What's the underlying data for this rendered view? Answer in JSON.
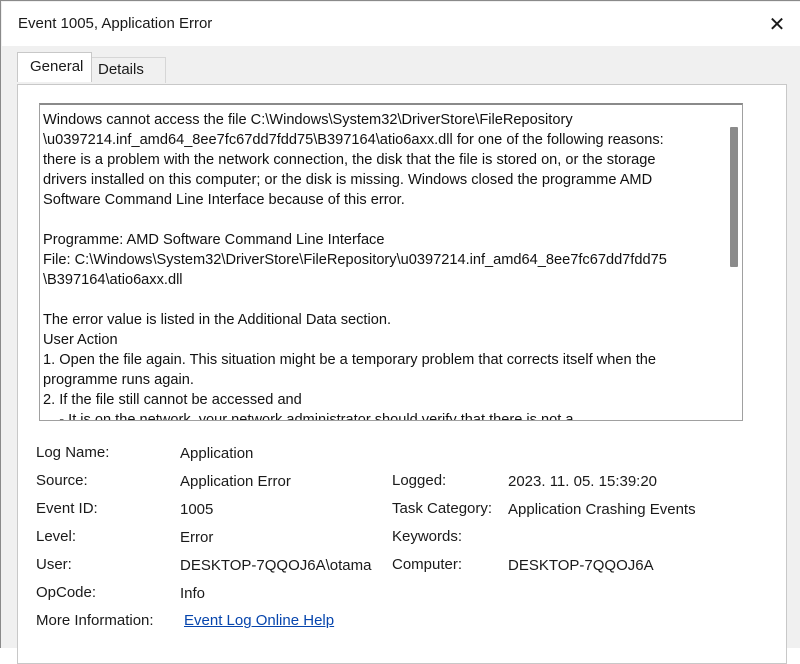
{
  "window": {
    "title": "Event 1005, Application Error",
    "close_glyph": "✕"
  },
  "tabs": [
    {
      "label": "General",
      "active": true
    },
    {
      "label": "Details",
      "active": false
    }
  ],
  "description": "Windows cannot access the file C:\\Windows\\System32\\DriverStore\\FileRepository\n\\u0397214.inf_amd64_8ee7fc67dd7fdd75\\B397164\\atio6axx.dll for one of the following reasons:\nthere is a problem with the network connection, the disk that the file is stored on, or the storage\ndrivers installed on this computer; or the disk is missing. Windows closed the programme AMD\nSoftware Command Line Interface because of this error.\n\nProgramme: AMD Software Command Line Interface\nFile: C:\\Windows\\System32\\DriverStore\\FileRepository\\u0397214.inf_amd64_8ee7fc67dd7fdd75\n\\B397164\\atio6axx.dll\n\nThe error value is listed in the Additional Data section.\nUser Action\n1. Open the file again. This situation might be a temporary problem that corrects itself when the\nprogramme runs again.\n2. If the file still cannot be accessed and\n    - It is on the network, your network administrator should verify that there is not a",
  "fields": {
    "log_name": {
      "label": "Log Name:",
      "value": "Application"
    },
    "source": {
      "label": "Source:",
      "value": "Application Error"
    },
    "logged": {
      "label": "Logged:",
      "value": "2023. 11. 05. 15:39:20"
    },
    "event_id": {
      "label": "Event ID:",
      "value": "1005"
    },
    "task_category": {
      "label": "Task Category:",
      "value": "Application Crashing Events"
    },
    "level": {
      "label": "Level:",
      "value": "Error"
    },
    "keywords": {
      "label": "Keywords:",
      "value": ""
    },
    "user": {
      "label": "User:",
      "value": "DESKTOP-7QQOJ6A\\otama"
    },
    "computer": {
      "label": "Computer:",
      "value": "DESKTOP-7QQOJ6A"
    },
    "opcode": {
      "label": "OpCode:",
      "value": "Info"
    },
    "more_info": {
      "label": "More Information:",
      "value": "Event Log Online Help"
    }
  }
}
